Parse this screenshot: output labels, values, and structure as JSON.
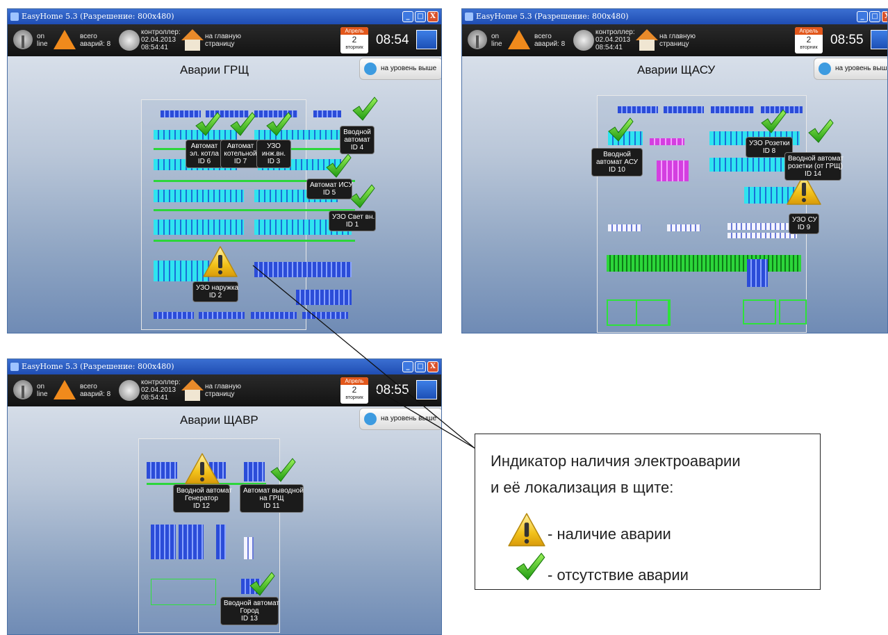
{
  "window_title": "EasyHome 5.3 (Разрешение: 800x480)",
  "window_buttons": {
    "minimize": "_",
    "maximize": "□",
    "close": "X"
  },
  "toolbar": {
    "online_line1": "on",
    "online_line2": "line",
    "alarms_line1": "всего",
    "alarms_line2": "аварий: 8",
    "controller_line1": "контроллер:",
    "controller_line2": "02.04.2013",
    "controller_line3": "08:54:41",
    "home_line1": "на главную",
    "home_line2": "страницу",
    "calendar_month": "Апрель",
    "calendar_day": "2",
    "calendar_weekday": "вторник"
  },
  "up_button_label": "на уровень выше",
  "windows": [
    {
      "time": "08:54",
      "page_title": "Аварии ГРЩ",
      "tags": [
        {
          "lines": [
            "Автомат",
            "эл. котла",
            "ID 6"
          ],
          "status": "ok"
        },
        {
          "lines": [
            "Автомат",
            "котельной",
            "ID 7"
          ],
          "status": "ok"
        },
        {
          "lines": [
            "УЗО",
            "инж.вн.",
            "ID 3"
          ],
          "status": "ok"
        },
        {
          "lines": [
            "Вводной",
            "автомат",
            "ID 4"
          ],
          "status": "ok"
        },
        {
          "lines": [
            "Автомат ИСУ",
            "ID 5"
          ],
          "status": "ok"
        },
        {
          "lines": [
            "УЗО Свет вн.",
            "ID 1"
          ],
          "status": "ok"
        },
        {
          "lines": [
            "УЗО  наружка",
            "ID 2"
          ],
          "status": "alarm"
        }
      ]
    },
    {
      "time": "08:55",
      "page_title": "Аварии ЩАСУ",
      "tags": [
        {
          "lines": [
            "Вводной",
            "автомат АСУ",
            "ID 10"
          ],
          "status": "ok"
        },
        {
          "lines": [
            "УЗО Розетки",
            "ID 8"
          ],
          "status": "ok"
        },
        {
          "lines": [
            "Вводной автомат",
            "розетки (от ГРЩ)",
            "ID 14"
          ],
          "status": "ok"
        },
        {
          "lines": [
            "УЗО СУ",
            "ID 9"
          ],
          "status": "alarm"
        }
      ]
    },
    {
      "time": "08:55",
      "page_title": "Аварии ЩАВР",
      "tags": [
        {
          "lines": [
            "Вводной автомат",
            "Генератор",
            "ID 12"
          ],
          "status": "alarm"
        },
        {
          "lines": [
            "Автомат выводной",
            "на ГРЩ",
            "ID 11"
          ],
          "status": "ok"
        },
        {
          "lines": [
            "Вводной автомат",
            "Город",
            "ID 13"
          ],
          "status": "ok"
        }
      ]
    }
  ],
  "legend": {
    "line1": "Индикатор наличия электроаварии",
    "line2": "и её локализация в щите:",
    "alarm_text": "- наличие аварии",
    "ok_text": "- отсутствие аварии"
  },
  "icons": {
    "alarm": "warning-triangle-icon",
    "ok": "green-checkmark-icon",
    "online": "antenna-icon",
    "controller": "clock-icon",
    "home": "home-icon",
    "up": "up-arrow-icon",
    "exit": "exit-icon"
  },
  "colors": {
    "alarm": "#f2c21b",
    "ok": "#34c21f",
    "module_cyan": "#2fe4f0",
    "module_blue": "#2b4cd8",
    "module_green": "#2cd63a"
  }
}
